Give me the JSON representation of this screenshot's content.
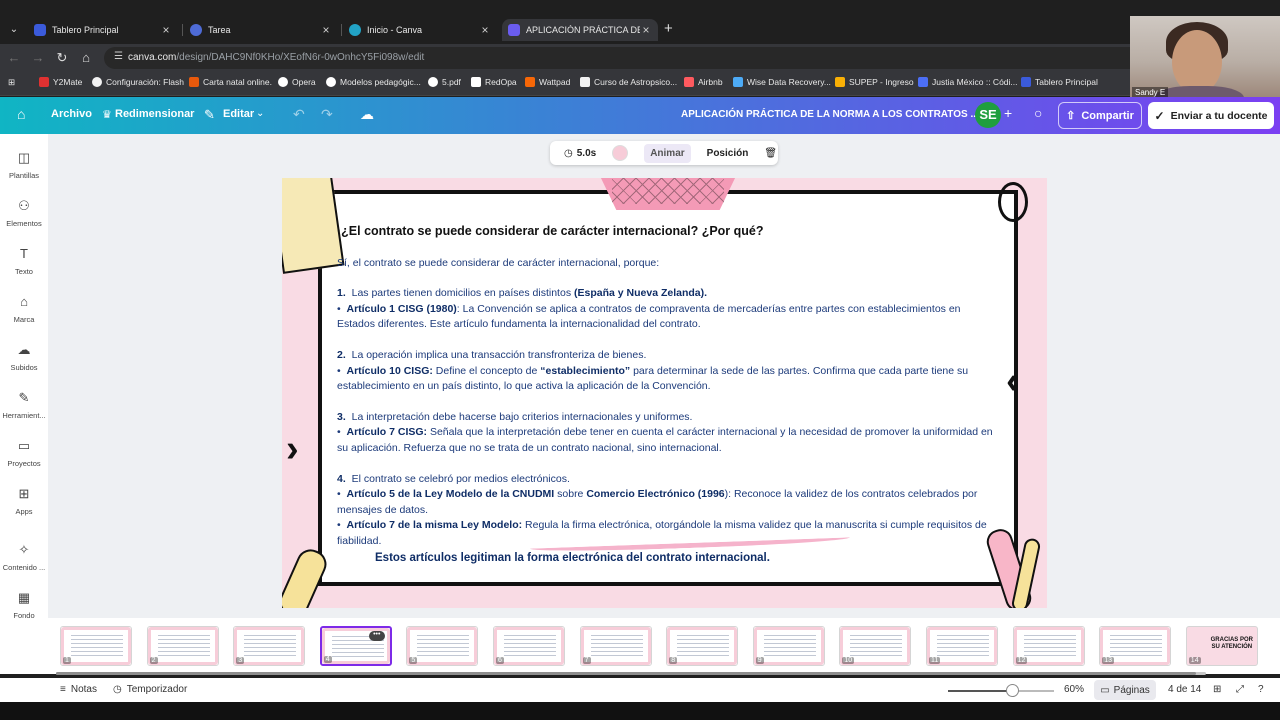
{
  "browser": {
    "tabs": [
      {
        "title": "Tablero Principal",
        "color": "#3b5bdb"
      },
      {
        "title": "Tarea",
        "color": "#4e6bd6"
      },
      {
        "title": "Inicio - Canva",
        "color": "#22a3c6"
      },
      {
        "title": "APLICACIÓN PRÁCTICA DE LA NORMA",
        "color": "#6a5cf0"
      }
    ],
    "url_host": "canva.com",
    "url_path": "/design/DAHC9Nf0KHo/XEofN6r-0wOnhcY5Fi098w/edit",
    "bookmarks": [
      {
        "label": "Y2Mate",
        "color": "#e03131"
      },
      {
        "label": "Configuración: Flash",
        "color": "#f2f2f2"
      },
      {
        "label": "Carta natal online.",
        "color": "#e8590c"
      },
      {
        "label": "Opera",
        "color": "#ffffff"
      },
      {
        "label": "Modelos pedagógic...",
        "color": "#ffffff"
      },
      {
        "label": "5.pdf",
        "color": "#ffffff"
      },
      {
        "label": "RedOpa",
        "color": "#ffffff"
      },
      {
        "label": "Wattpad",
        "color": "#f76707"
      },
      {
        "label": "Curso de Astropsico...",
        "color": "#f2f2f2"
      },
      {
        "label": "Airbnb",
        "color": "#ff5a5f"
      },
      {
        "label": "Wise Data Recovery...",
        "color": "#4dabf7"
      },
      {
        "label": "SUPEP - Ingreso",
        "color": "#fab005"
      },
      {
        "label": "Justia México :: Códi...",
        "color": "#4c6ef5"
      },
      {
        "label": "Tablero Principal",
        "color": "#3b5bdb"
      }
    ]
  },
  "webcam": {
    "name": "Sandy E"
  },
  "canva": {
    "header": {
      "file": "Archivo",
      "resize": "Redimensionar",
      "edit": "Editar",
      "doc_title": "APLICACIÓN PRÁCTICA DE LA NORMA  A LOS CONTRATOS ...",
      "avatar": "SE",
      "share": "Compartir",
      "send": "Enviar a tu docente"
    },
    "sidebar": [
      {
        "label": "Plantillas",
        "icon": "◫"
      },
      {
        "label": "Elementos",
        "icon": "⚇"
      },
      {
        "label": "Texto",
        "icon": "T"
      },
      {
        "label": "Marca",
        "icon": "⌂"
      },
      {
        "label": "Subidos",
        "icon": "☁"
      },
      {
        "label": "Herramient...",
        "icon": "✎"
      },
      {
        "label": "Proyectos",
        "icon": "▭"
      },
      {
        "label": "Apps",
        "icon": "⊞"
      },
      {
        "label": "Contenido ...",
        "icon": "✧"
      },
      {
        "label": "Fondo",
        "icon": "▦"
      }
    ],
    "toolbar": {
      "duration": "5.0s",
      "animate": "Animar",
      "position": "Posición"
    },
    "slide": {
      "question": "·¿El contrato se puede considerar de carácter internacional? ¿Por qué?",
      "intro": "Sí, el contrato se puede considerar de carácter internacional, porque:",
      "p1_num": "1.",
      "p1_text": "Las partes tienen domicilios en países distintos",
      "p1_bold": "(España y Nueva Zelanda).",
      "p1b_bold": "Artículo 1 CISG (1980)",
      "p1b_text": ": La Convención se aplica a contratos de compraventa de mercaderías entre partes con establecimientos en Estados diferentes. Este artículo fundamenta la internacionalidad del contrato.",
      "p2_num": "2.",
      "p2_text": "La operación implica una transacción transfronteriza de bienes.",
      "p2b_bold": "Artículo 10 CISG:",
      "p2b_text1": " Define el concepto de ",
      "p2b_bold2": "“establecimiento”",
      "p2b_text2": " para determinar la sede de las partes.  Confirma que cada parte tiene su establecimiento en un país distinto, lo que activa la aplicación de la Convención.",
      "p3_num": "3.",
      "p3_text": "La interpretación debe hacerse bajo criterios internacionales y uniformes.",
      "p3b_bold": "Artículo 7 CISG:",
      "p3b_text": " Señala que la interpretación debe tener en cuenta el carácter internacional y la necesidad de promover la uniformidad en su aplicación. Refuerza que no se trata de un contrato nacional, sino internacional.",
      "p4_num": "4.",
      "p4_text": "El contrato se celebró por medios electrónicos.",
      "p4b_bold": "Artículo 5 de la Ley Modelo de la CNUDMI",
      "p4b_text1": " sobre ",
      "p4b_bold2": "Comercio Electrónico (1996",
      "p4b_text2": "): Reconoce la validez de los contratos celebrados por mensajes de datos.",
      "p4c_bold": "Artículo 7 de la misma Ley Modelo:",
      "p4c_text": " Regula la firma electrónica, otorgándole la misma validez que la manuscrita si cumple requisitos de fiabilidad.",
      "conclusion": "Estos artículos legitiman la forma electrónica del contrato internacional."
    },
    "pages": [
      "1",
      "2",
      "3",
      "4",
      "5",
      "6",
      "7",
      "8",
      "9",
      "10",
      "11",
      "12",
      "13",
      "14"
    ],
    "selected_page": 4,
    "last_thumb_label": "GRACIAS POR SU ATENCIÓN",
    "bottom": {
      "notes": "Notas",
      "timer": "Temporizador",
      "zoom": "60%",
      "zoom_fraction": 0.6,
      "pages": "Páginas",
      "page_of": "4 de 14"
    }
  }
}
